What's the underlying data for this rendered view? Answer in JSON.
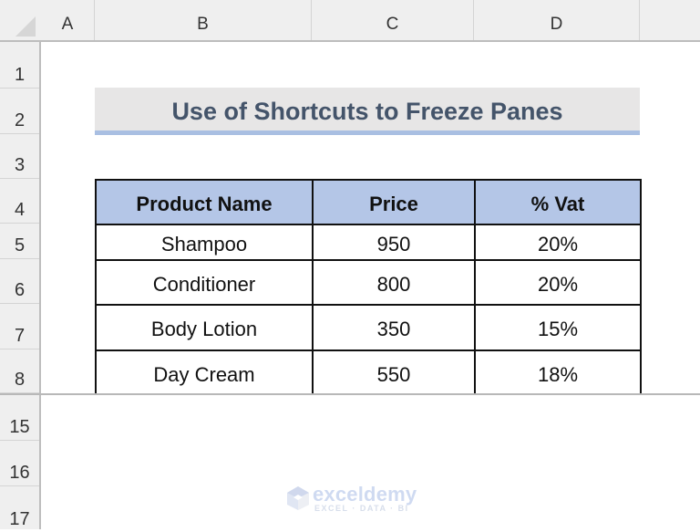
{
  "spreadsheet": {
    "column_headers": [
      "A",
      "B",
      "C",
      "D"
    ],
    "row_headers_frozen": [
      "1",
      "2",
      "3",
      "4",
      "5",
      "6",
      "7",
      "8"
    ],
    "row_headers_scrolled": [
      "15",
      "16",
      "17"
    ],
    "title": "Use of Shortcuts to Freeze Panes",
    "table": {
      "headers": [
        "Product Name",
        "Price",
        "% Vat"
      ],
      "rows": [
        [
          "Shampoo",
          "950",
          "20%"
        ],
        [
          "Conditioner",
          "800",
          "20%"
        ],
        [
          "Body Lotion",
          "350",
          "15%"
        ],
        [
          "Day Cream",
          "550",
          "18%"
        ]
      ]
    }
  },
  "colors": {
    "header_fill": "#b4c6e7",
    "title_fill": "#e7e6e6",
    "title_text": "#44546a",
    "title_underline": "#a9bfe2"
  },
  "watermark": {
    "brand": "exceldemy",
    "tagline": "EXCEL · DATA · BI",
    "icon": "exceldemy-logo-icon"
  }
}
